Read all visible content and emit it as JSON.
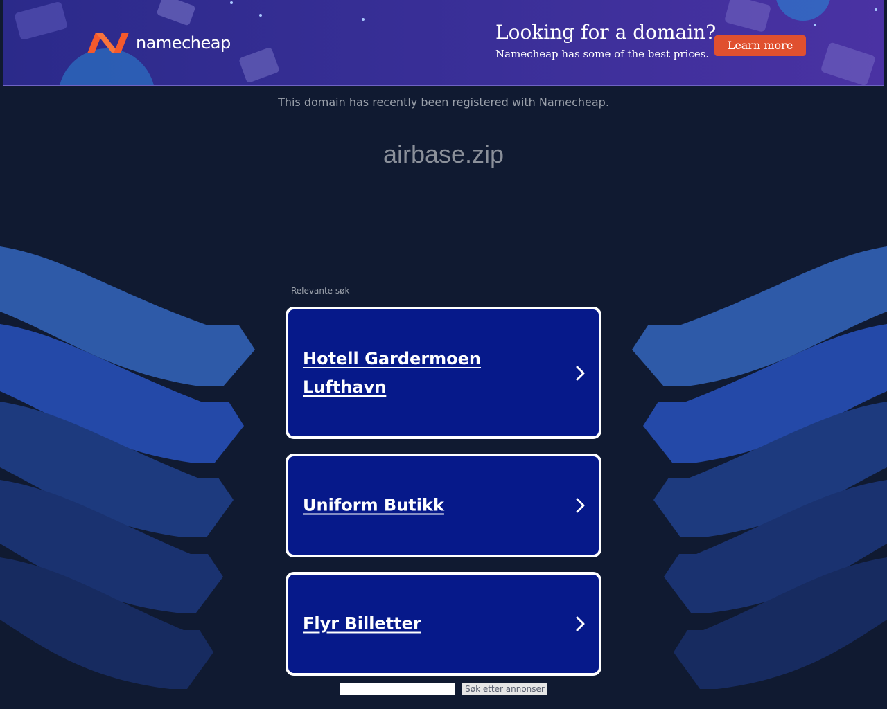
{
  "banner": {
    "logo_text": "namecheap",
    "promo_title": "Looking for a domain?",
    "promo_subtitle": "Namecheap has some of the best prices.",
    "learn_more_label": "Learn more",
    "colors": {
      "logo_accent": "#f4592c",
      "button": "#e0502f"
    }
  },
  "notice": "This domain has recently been registered with Namecheap.",
  "domain": "airbase.zip",
  "related": {
    "label": "Relevante søk",
    "items": [
      {
        "label": "Hotell Gardermoen Lufthavn"
      },
      {
        "label": "Uniform Butikk"
      },
      {
        "label": "Flyr Billetter"
      }
    ]
  },
  "search": {
    "input_value": "",
    "button_label": "Søk etter annonser"
  },
  "colors": {
    "background": "#101a31",
    "card": "#06198a",
    "wave_light": "#2e5aa8",
    "wave_mid": "#2449a8",
    "wave_dark": "#1a3270"
  }
}
